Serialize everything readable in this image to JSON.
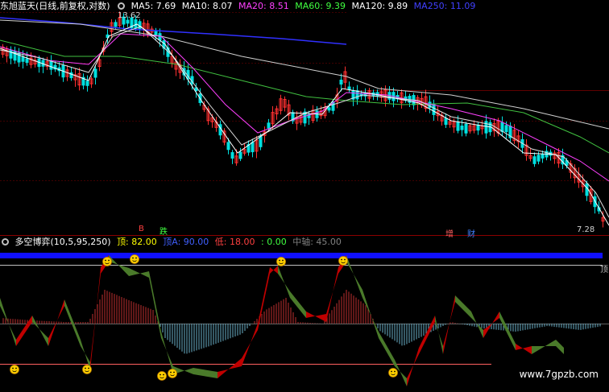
{
  "main_legend": {
    "title": "东旭蓝天(日线,前复权,对数)",
    "items": [
      {
        "label": "MA5: 7.69",
        "color": "#ffffff"
      },
      {
        "label": "MA10: 8.07",
        "color": "#ffffff"
      },
      {
        "label": "MA20: 8.51",
        "color": "#ff40ff"
      },
      {
        "label": "MA60: 9.39",
        "color": "#40ff40"
      },
      {
        "label": "MA120: 9.89",
        "color": "#ffffff"
      },
      {
        "label": "MA250: 11.09",
        "color": "#4040ff"
      }
    ]
  },
  "osc_legend": {
    "title": "多空博弈(10,5,95,250)",
    "items": [
      {
        "label": "顶: 82.00",
        "color": "#ffff00"
      },
      {
        "label": "顶A: 90.00",
        "color": "#4060ff"
      },
      {
        "label": "低: 18.00",
        "color": "#ff4040"
      },
      {
        "label": ": 0.00",
        "color": "#40ff40"
      },
      {
        "label": "中轴: 45.00",
        "color": "#808080"
      }
    ]
  },
  "annotations": {
    "high_price": "13.62",
    "low_price": "7.28",
    "right_marker": "顶",
    "markers": [
      {
        "text": "B",
        "color": "#ff4040"
      },
      {
        "text": "跌",
        "color": "#40ff40"
      },
      {
        "text": "增",
        "color": "#ff6060"
      },
      {
        "text": "财",
        "color": "#4080ff"
      }
    ]
  },
  "watermark": "www.7gpzb.com",
  "colors": {
    "up": "#ff3030",
    "down": "#00e0e0",
    "ma5": "#ffffff",
    "ma10": "#e0e0e0",
    "ma20": "#ff40ff",
    "ma60": "#40c040",
    "ma250": "#3030ff",
    "bull_ribbon": "#c00000",
    "bear_ribbon": "#4a7a2a"
  }
}
